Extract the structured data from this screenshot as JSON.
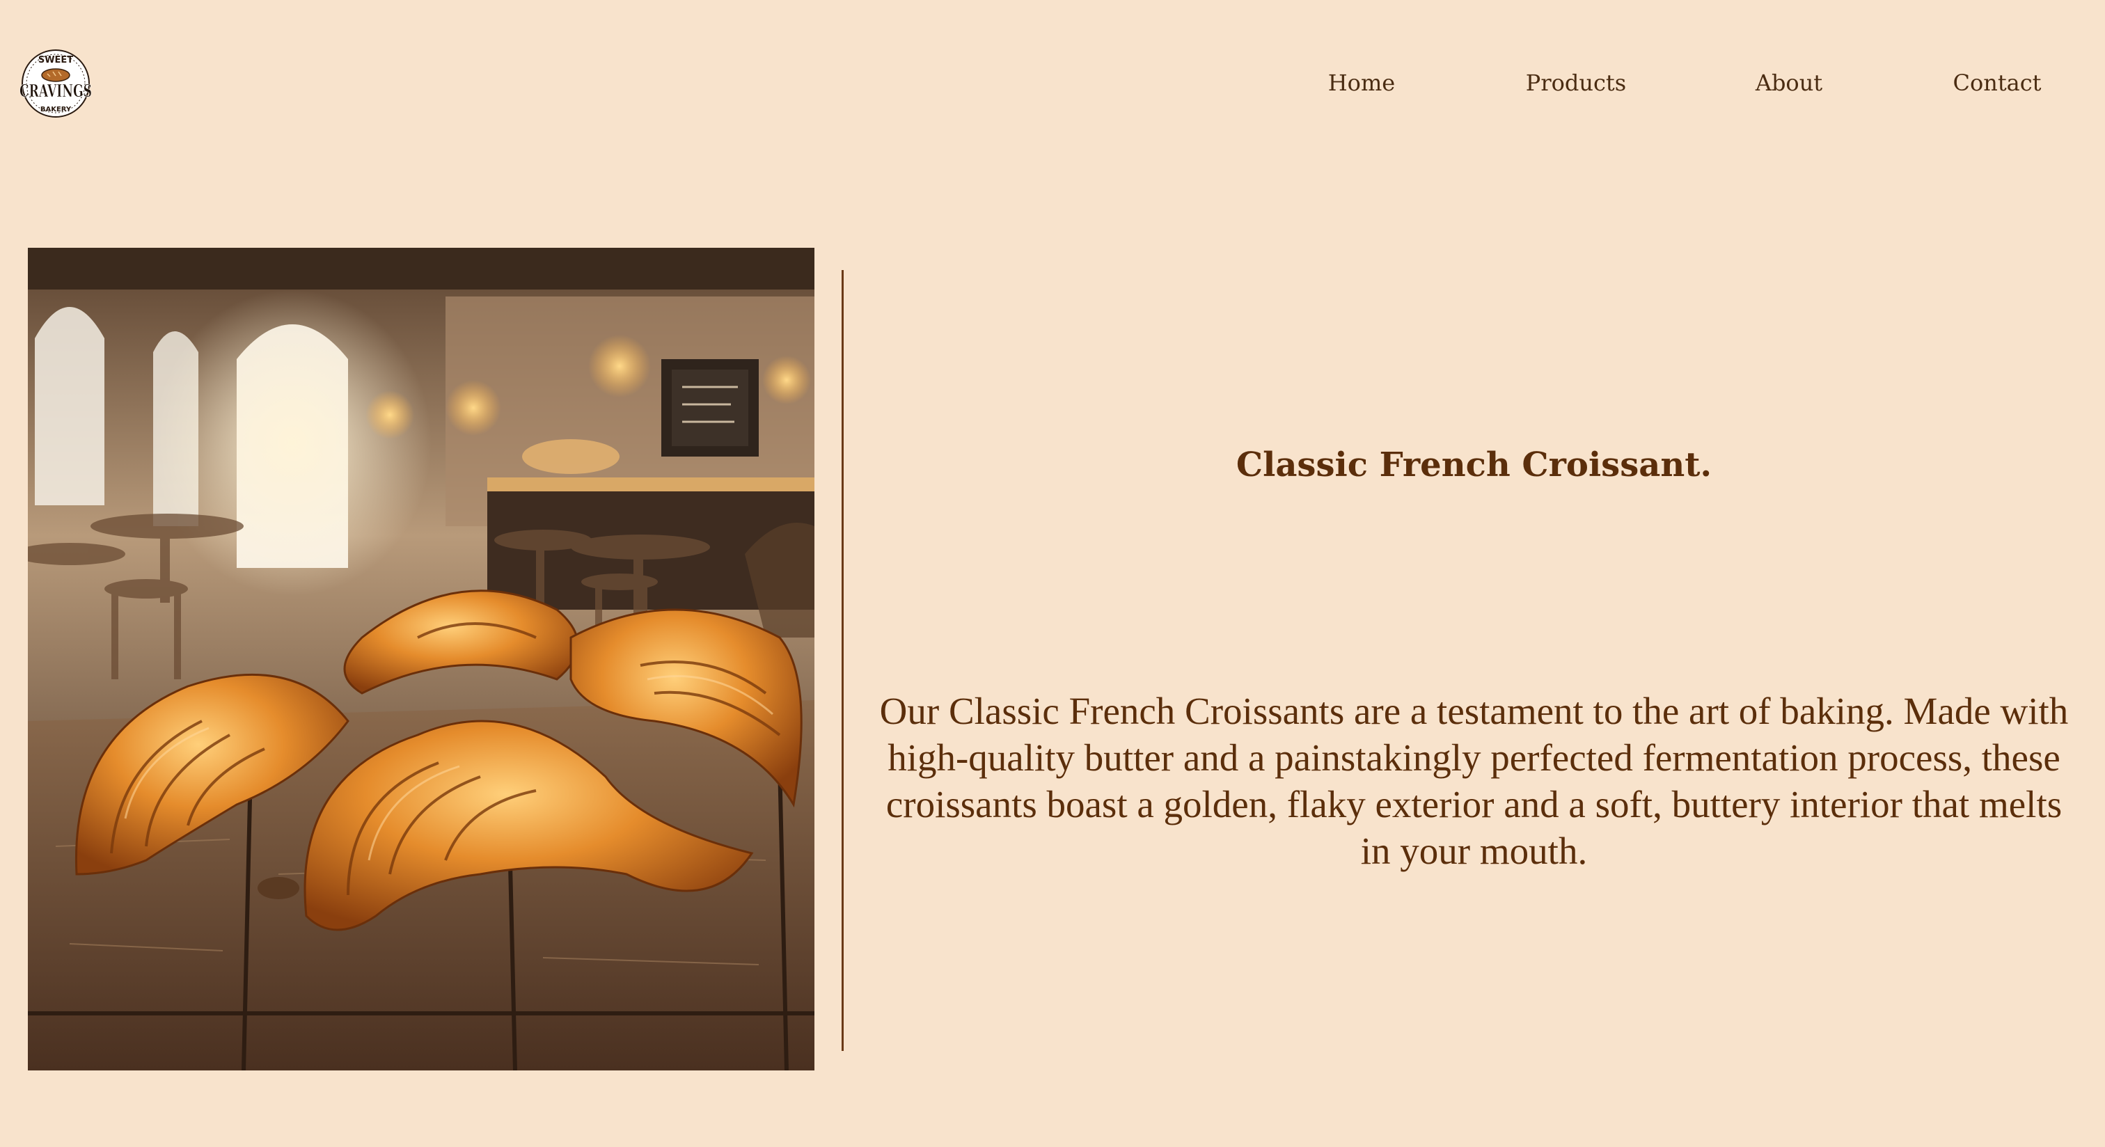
{
  "logo": {
    "top_text": "SWEET",
    "main_text": "CRAVINGS",
    "bottom_text": "BAKERY"
  },
  "nav": {
    "items": [
      "Home",
      "Products",
      "About",
      "Contact"
    ]
  },
  "product": {
    "title": "Classic French Croissant.",
    "description": "Our Classic French Croissants are a testament to the art of baking. Made with high-quality butter and a painstakingly perfected fermentation process, these croissants boast a golden, flaky exterior and a soft, buttery interior that melts in your mouth."
  },
  "colors": {
    "background": "#f8e3cc",
    "text": "#5b2e0b",
    "divider": "#6b3a17"
  }
}
